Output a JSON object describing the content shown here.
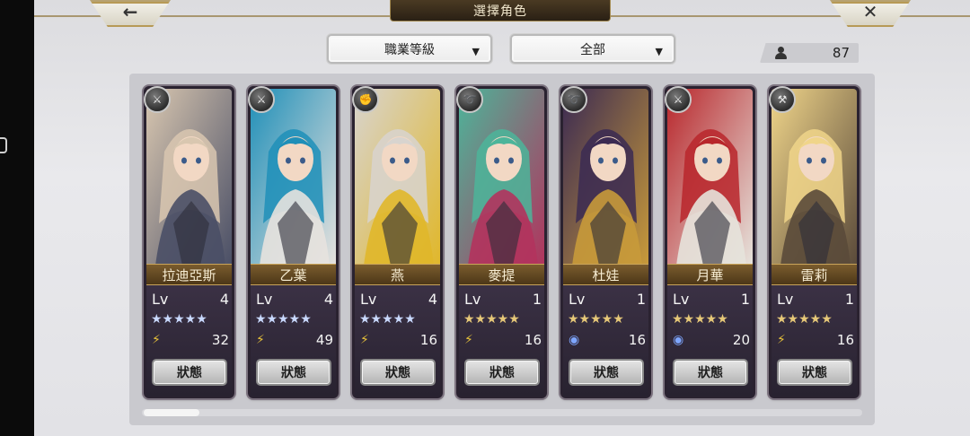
{
  "header": {
    "title": "選擇角色",
    "back_label": "←",
    "close_label": "✕"
  },
  "filters": {
    "job_label": "職業等級",
    "scope_label": "全部",
    "arrow": "▼"
  },
  "roster_count": "87",
  "characters": [
    {
      "name": "拉迪亞斯",
      "lv_label": "Lv",
      "level": "4",
      "stars": "★★★★★",
      "star_color": "blue",
      "element": "wind",
      "element_glyph": "⚡",
      "value": "32",
      "weapon": "sword",
      "weapon_glyph": "⚔",
      "status_label": "狀態",
      "palette": [
        "#d9c7b0",
        "#4a4f66"
      ]
    },
    {
      "name": "乙葉",
      "lv_label": "Lv",
      "level": "4",
      "stars": "★★★★★",
      "star_color": "blue",
      "element": "wind",
      "element_glyph": "⚡",
      "value": "49",
      "weapon": "sword",
      "weapon_glyph": "⚔",
      "status_label": "狀態",
      "palette": [
        "#1f8fb8",
        "#e7e2de"
      ]
    },
    {
      "name": "燕",
      "lv_label": "Lv",
      "level": "4",
      "stars": "★★★★★",
      "star_color": "blue",
      "element": "wind",
      "element_glyph": "⚡",
      "value": "16",
      "weapon": "gauntlet",
      "weapon_glyph": "✊",
      "status_label": "狀態",
      "palette": [
        "#d8d4cf",
        "#e0b72a"
      ]
    },
    {
      "name": "麥提",
      "lv_label": "Lv",
      "level": "1",
      "stars": "★★★★★",
      "star_color": "gold",
      "element": "wind",
      "element_glyph": "⚡",
      "value": "16",
      "weapon": "whip",
      "weapon_glyph": "➰",
      "status_label": "狀態",
      "palette": [
        "#4cb59a",
        "#b2335d"
      ]
    },
    {
      "name": "杜娃",
      "lv_label": "Lv",
      "level": "1",
      "stars": "★★★★★",
      "star_color": "gold",
      "element": "water",
      "element_glyph": "◉",
      "value": "16",
      "weapon": "whip",
      "weapon_glyph": "➰",
      "status_label": "狀態",
      "palette": [
        "#3b2a52",
        "#c89a3a"
      ]
    },
    {
      "name": "月華",
      "lv_label": "Lv",
      "level": "1",
      "stars": "★★★★★",
      "star_color": "gold",
      "element": "water",
      "element_glyph": "◉",
      "value": "20",
      "weapon": "sword",
      "weapon_glyph": "⚔",
      "status_label": "狀態",
      "palette": [
        "#b8262b",
        "#e6e3dc"
      ]
    },
    {
      "name": "雷莉",
      "lv_label": "Lv",
      "level": "1",
      "stars": "★★★★★",
      "star_color": "gold",
      "element": "wind",
      "element_glyph": "⚡",
      "value": "16",
      "weapon": "axe",
      "weapon_glyph": "⚒",
      "status_label": "狀態",
      "palette": [
        "#f0d58a",
        "#5a4a3a"
      ]
    }
  ],
  "scroll_position": 0
}
